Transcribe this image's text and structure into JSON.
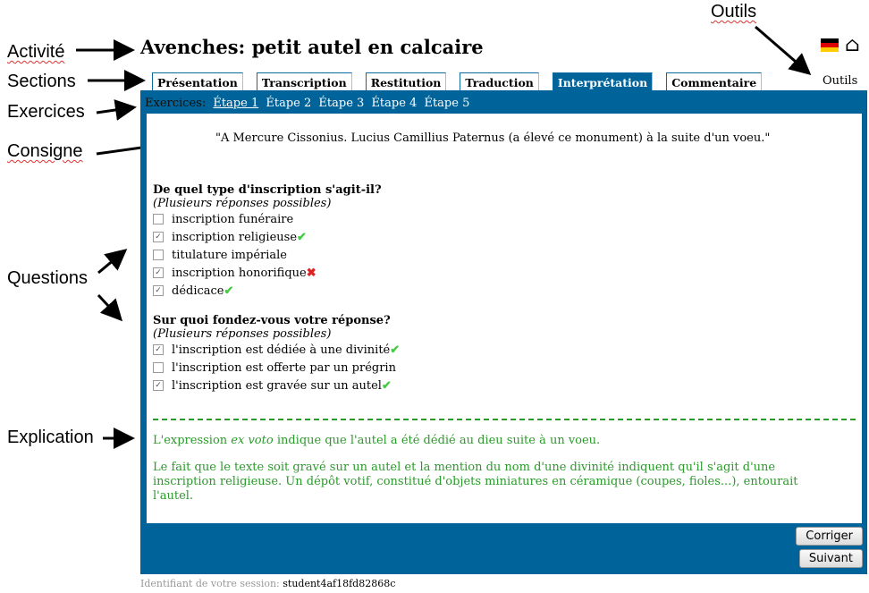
{
  "annotations": {
    "activite": "Activité",
    "sections": "Sections",
    "exercices": "Exercices",
    "consigne": "Consigne",
    "questions": "Questions",
    "explication": "Explication",
    "outils": "Outils"
  },
  "title": "Avenches: petit autel en calcaire",
  "tabs": [
    "Présentation",
    "Transcription",
    "Restitution",
    "Traduction",
    "Interprétation",
    "Commentaire"
  ],
  "active_tab": "Interprétation",
  "outils": "Outils",
  "exercises": {
    "label": "Exercices:",
    "steps": [
      "Étape 1",
      "Étape 2",
      "Étape 3",
      "Étape 4",
      "Étape 5"
    ],
    "current": "Étape 1"
  },
  "consigne": "\"A Mercure Cissonius. Lucius Camillius Paternus (a élevé ce monument) à la suite d'un voeu.\"",
  "questions": [
    {
      "title": "De quel type d'inscription s'agit-il?",
      "hint": "(Plusieurs réponses possibles)",
      "options": [
        {
          "label": "inscription funéraire",
          "checked": false,
          "result": ""
        },
        {
          "label": "inscription religieuse",
          "checked": true,
          "result": "correct"
        },
        {
          "label": "titulature impériale",
          "checked": false,
          "result": ""
        },
        {
          "label": "inscription honorifique",
          "checked": true,
          "result": "wrong"
        },
        {
          "label": "dédicace",
          "checked": true,
          "result": "correct"
        }
      ]
    },
    {
      "title": "Sur quoi fondez-vous votre réponse?",
      "hint": "(Plusieurs réponses possibles)",
      "options": [
        {
          "label": "l'inscription est dédiée à une divinité",
          "checked": true,
          "result": "correct"
        },
        {
          "label": "l'inscription est offerte par un prégrin",
          "checked": false,
          "result": ""
        },
        {
          "label": "l'inscription est gravée sur un autel",
          "checked": true,
          "result": "correct"
        }
      ]
    }
  ],
  "explication": {
    "p1_before": "L'expression ",
    "p1_em": "ex voto",
    "p1_after": " indique que l'autel a été dédié au dieu suite à un voeu.",
    "p2": "Le fait que le texte soit gravé sur un autel et la mention du nom d'une divinité indiquent qu'il s'agit d'une inscription religieuse. Un dépôt votif, constitué d'objets miniatures en céramique (coupes, fioles...), entourait l'autel."
  },
  "buttons": {
    "corriger": "Corriger",
    "suivant": "Suivant"
  },
  "session": {
    "label": "Identifiant de votre session:",
    "id": "student4af18fd82868c"
  },
  "colors": {
    "panel": "#00649a",
    "correct": "#44cc44",
    "wrong": "#dd2222",
    "explication": "#2a9a2a"
  }
}
